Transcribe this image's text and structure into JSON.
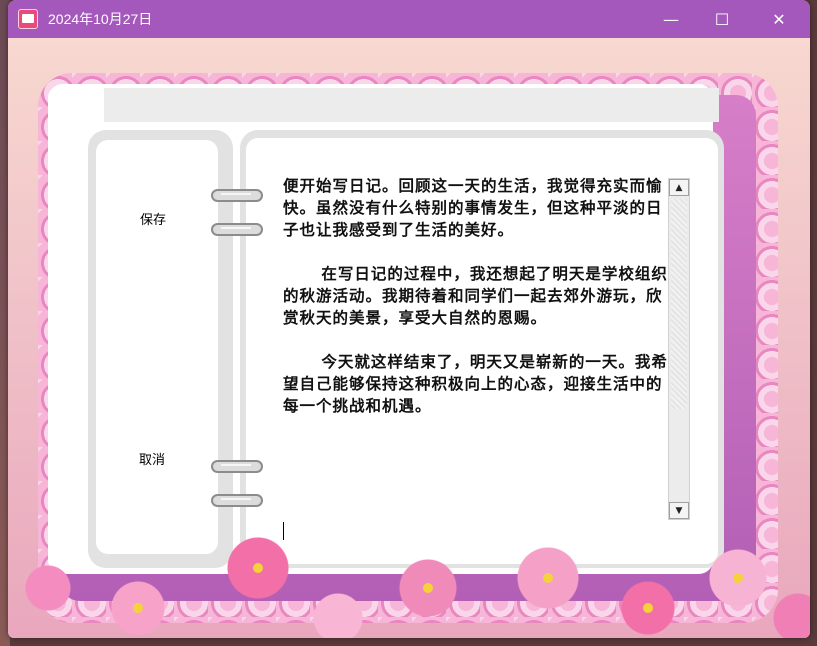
{
  "window": {
    "title": "2024年10月27日",
    "icon": "diary-app-icon",
    "controls": {
      "minimize": "—",
      "maximize": "☐",
      "close": "✕"
    }
  },
  "sidebar": {
    "save_label": "保存",
    "cancel_label": "取消"
  },
  "editor": {
    "content": "便开始写日记。回顾这一天的生活，我觉得充实而愉快。虽然没有什么特别的事情发生，但这种平淡的日子也让我感受到了生活的美好。\n\n      在写日记的过程中，我还想起了明天是学校组织的秋游活动。我期待着和同学们一起去郊外游玩，欣赏秋天的美景，享受大自然的恩赐。\n\n      今天就这样结束了，明天又是崭新的一天。我希望自己能够保持这种积极向上的心态，迎接生活中的每一个挑战和机遇。"
  },
  "colors": {
    "titlebar": "#a458bb",
    "frame_inner": "#c068bd",
    "text": "#111111"
  }
}
